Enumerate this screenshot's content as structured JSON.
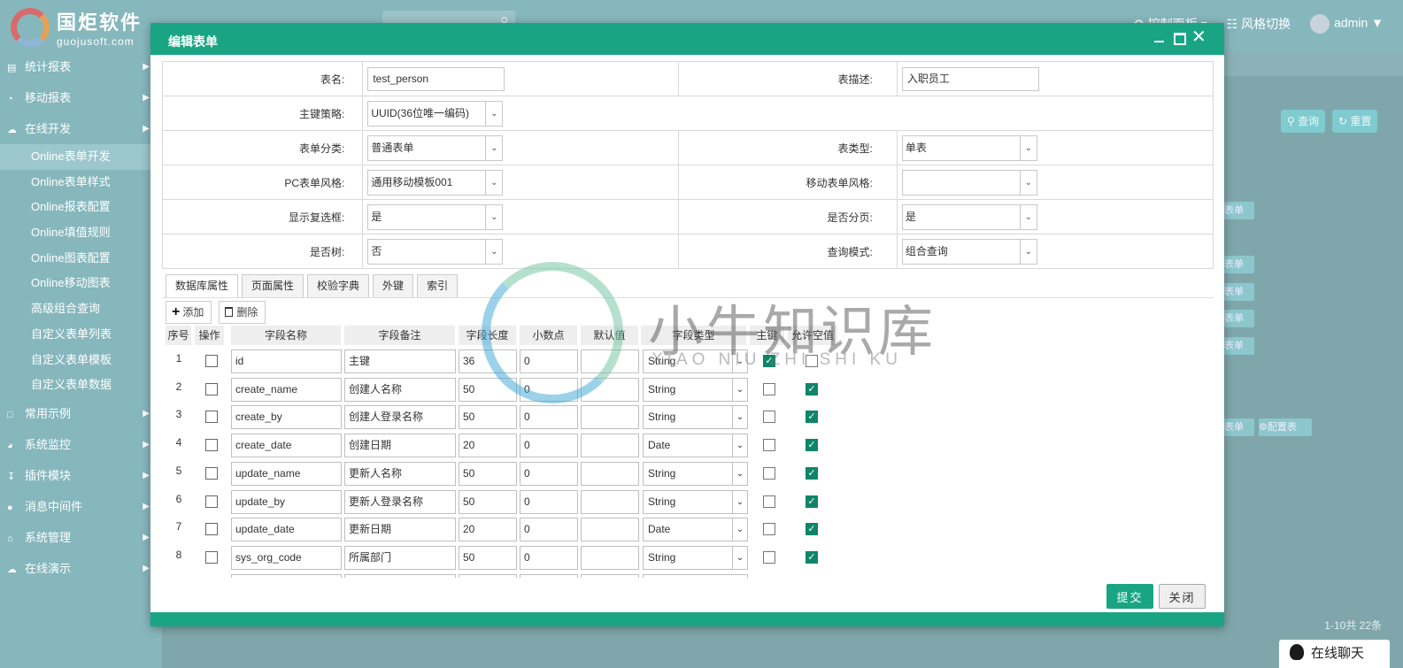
{
  "brand": {
    "name_cn": "国炬软件",
    "name_en": "guojusoft.com"
  },
  "topbar": {
    "panel_label": "控制面板",
    "style_switch": "风格切换",
    "user": "admin"
  },
  "sidebar": {
    "groups_before": [
      {
        "label": "统计报表",
        "icon": "chart-icon"
      },
      {
        "label": "移动报表",
        "icon": "pie-icon"
      },
      {
        "label": "在线开发",
        "icon": "cloud-icon"
      }
    ],
    "sub_items": [
      "Online表单开发",
      "Online表单样式",
      "Online报表配置",
      "Online填值规则",
      "Online图表配置",
      "Online移动图表",
      "高级组合查询",
      "自定义表单列表",
      "自定义表单模板",
      "自定义表单数据"
    ],
    "active_sub": "Online表单开发",
    "groups_after": [
      {
        "label": "常用示例",
        "icon": "comment-icon"
      },
      {
        "label": "系统监控",
        "icon": "monitor-icon"
      },
      {
        "label": "插件模块",
        "icon": "download-icon"
      },
      {
        "label": "消息中间件",
        "icon": "message-icon"
      },
      {
        "label": "系统管理",
        "icon": "home-icon"
      },
      {
        "label": "在线演示",
        "icon": "cloud-icon"
      }
    ]
  },
  "background": {
    "query_btn": "查询",
    "reset_btn": "重置",
    "row_chip": "表单",
    "config_chip": "配置表",
    "pager": "1-10共 22条",
    "chat": "在线聊天"
  },
  "modal": {
    "title": "编辑表单",
    "props": {
      "table_name_label": "表名:",
      "table_name": "test_person",
      "table_desc_label": "表描述:",
      "table_desc": "入职员工",
      "pk_strategy_label": "主键策略:",
      "pk_strategy": "UUID(36位唯一编码)",
      "form_category_label": "表单分类:",
      "form_category": "普通表单",
      "table_type_label": "表类型:",
      "table_type": "单表",
      "pc_style_label": "PC表单风格:",
      "pc_style": "通用移动模板001",
      "mobile_style_label": "移动表单风格:",
      "mobile_style": "",
      "show_checkbox_label": "显示复选框:",
      "show_checkbox": "是",
      "paging_label": "是否分页:",
      "paging": "是",
      "is_tree_label": "是否树:",
      "is_tree": "否",
      "query_mode_label": "查询模式:",
      "query_mode": "组合查询"
    },
    "tabs": [
      "数据库属性",
      "页面属性",
      "校验字典",
      "外键",
      "索引"
    ],
    "toolbar": {
      "add": "添加",
      "delete": "删除"
    },
    "columns": [
      "序号",
      "操作",
      "字段名称",
      "字段备注",
      "字段长度",
      "小数点",
      "默认值",
      "字段类型",
      "主键",
      "允许空值"
    ],
    "rows": [
      {
        "idx": "1",
        "name": "id",
        "comment": "主键",
        "length": "36",
        "decimal": "0",
        "default": "",
        "type": "String",
        "pk": true,
        "nullable": false
      },
      {
        "idx": "2",
        "name": "create_name",
        "comment": "创建人名称",
        "length": "50",
        "decimal": "0",
        "default": "",
        "type": "String",
        "pk": false,
        "nullable": true
      },
      {
        "idx": "3",
        "name": "create_by",
        "comment": "创建人登录名称",
        "length": "50",
        "decimal": "0",
        "default": "",
        "type": "String",
        "pk": false,
        "nullable": true
      },
      {
        "idx": "4",
        "name": "create_date",
        "comment": "创建日期",
        "length": "20",
        "decimal": "0",
        "default": "",
        "type": "Date",
        "pk": false,
        "nullable": true
      },
      {
        "idx": "5",
        "name": "update_name",
        "comment": "更新人名称",
        "length": "50",
        "decimal": "0",
        "default": "",
        "type": "String",
        "pk": false,
        "nullable": true
      },
      {
        "idx": "6",
        "name": "update_by",
        "comment": "更新人登录名称",
        "length": "50",
        "decimal": "0",
        "default": "",
        "type": "String",
        "pk": false,
        "nullable": true
      },
      {
        "idx": "7",
        "name": "update_date",
        "comment": "更新日期",
        "length": "20",
        "decimal": "0",
        "default": "",
        "type": "Date",
        "pk": false,
        "nullable": true
      },
      {
        "idx": "8",
        "name": "sys_org_code",
        "comment": "所属部门",
        "length": "50",
        "decimal": "0",
        "default": "",
        "type": "String",
        "pk": false,
        "nullable": true
      }
    ],
    "submit": "提交",
    "close": "关闭"
  },
  "watermark": {
    "cn": "小牛知识库",
    "pinyin": "XIAO NIU ZHI SHI KU"
  },
  "colors": {
    "accent": "#19a583",
    "checkbox_on": "#0f8569"
  }
}
